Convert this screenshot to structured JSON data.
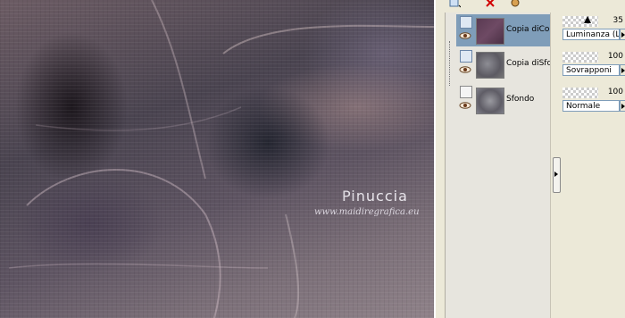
{
  "canvas": {
    "watermark_title": "Pinuccia",
    "watermark_url": "www.maidiregrafica.eu"
  },
  "toolbar": {
    "icons": [
      "new-layer-icon",
      "delete-layer-icon",
      "paint-icon"
    ]
  },
  "layers": [
    {
      "name": "Copia diCop",
      "type": "vector",
      "visible": true,
      "selected": true
    },
    {
      "name": "Copia diSfon",
      "type": "vector",
      "visible": true,
      "selected": false
    },
    {
      "name": "Sfondo",
      "type": "raster",
      "visible": true,
      "selected": false
    }
  ],
  "properties": [
    {
      "opacity": "35",
      "blend_mode": "Luminanza (L)"
    },
    {
      "opacity": "100",
      "blend_mode": "Sovrapponi"
    },
    {
      "opacity": "100",
      "blend_mode": "Normale"
    }
  ],
  "colors": {
    "selection": "#7f9db9",
    "panel_bg": "#ece9d8"
  }
}
